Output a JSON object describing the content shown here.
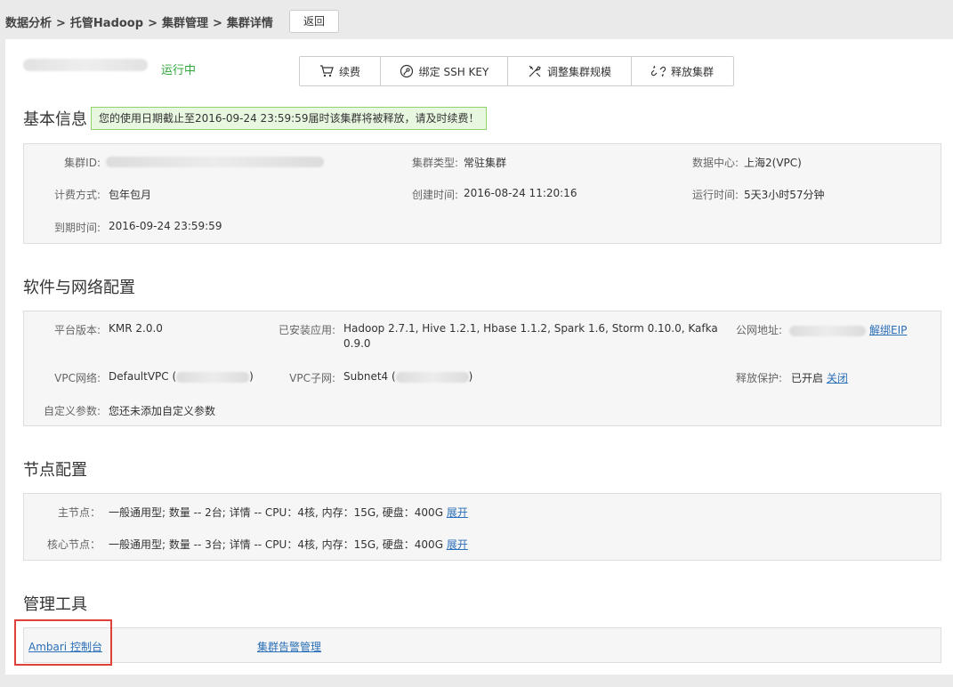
{
  "breadcrumb": {
    "items": [
      "数据分析",
      "托管Hadoop",
      "集群管理",
      "集群详情"
    ],
    "sep": ">"
  },
  "back_label": "返回",
  "status": {
    "text": "运行中",
    "color": "#2fa83a"
  },
  "actions": [
    {
      "label": "续费",
      "icon": "cart-icon"
    },
    {
      "label": "绑定 SSH KEY",
      "icon": "key-icon"
    },
    {
      "label": "调整集群规模",
      "icon": "tools-icon"
    },
    {
      "label": "释放集群",
      "icon": "unlink-icon"
    }
  ],
  "basic": {
    "title": "基本信息",
    "notice": "您的使用日期截止至2016-09-24 23:59:59届时该集群将被释放，请及时续费！",
    "fields": {
      "cluster_id_label": "集群ID:",
      "cluster_type_label": "集群类型:",
      "cluster_type": "常驻集群",
      "datacenter_label": "数据中心:",
      "datacenter": "上海2(VPC)",
      "billing_label": "计费方式:",
      "billing": "包年包月",
      "created_label": "创建时间:",
      "created": "2016-08-24 11:20:16",
      "runtime_label": "运行时间:",
      "runtime": "5天3小时57分钟",
      "expire_label": "到期时间:",
      "expire": "2016-09-24 23:59:59"
    }
  },
  "software": {
    "title": "软件与网络配置",
    "platform_label": "平台版本:",
    "platform": "KMR 2.0.0",
    "apps_label": "已安装应用:",
    "apps_line1": "Hadoop 2.7.1, Hive 1.2.1, Hbase 1.1.2, Spark 1.6, Storm 0.10.0, Kafka",
    "apps_line2": "0.9.0",
    "eip_label": "公网地址:",
    "eip_action": "解绑EIP",
    "vpc_label": "VPC网络:",
    "vpc": "DefaultVPC (",
    "vpc_close": ")",
    "subnet_label": "VPC子网:",
    "subnet": "Subnet4 (",
    "subnet_close": ")",
    "protect_label": "释放保护:",
    "protect": "已开启",
    "protect_action": "关闭",
    "custom_label": "自定义参数:",
    "custom": "您还未添加自定义参数"
  },
  "nodes": {
    "title": "节点配置",
    "master_label": "主节点：",
    "master": "一般通用型; 数量 -- 2台; 详情 -- CPU：4核, 内存：15G, 硬盘：400G",
    "master_expand": "展开",
    "core_label": "核心节点：",
    "core": "一般通用型; 数量 -- 3台; 详情 -- CPU：4核, 内存：15G, 硬盘：400G",
    "core_expand": "展开"
  },
  "tools": {
    "title": "管理工具",
    "ambari": "Ambari 控制台",
    "alarm": "集群告警管理"
  }
}
